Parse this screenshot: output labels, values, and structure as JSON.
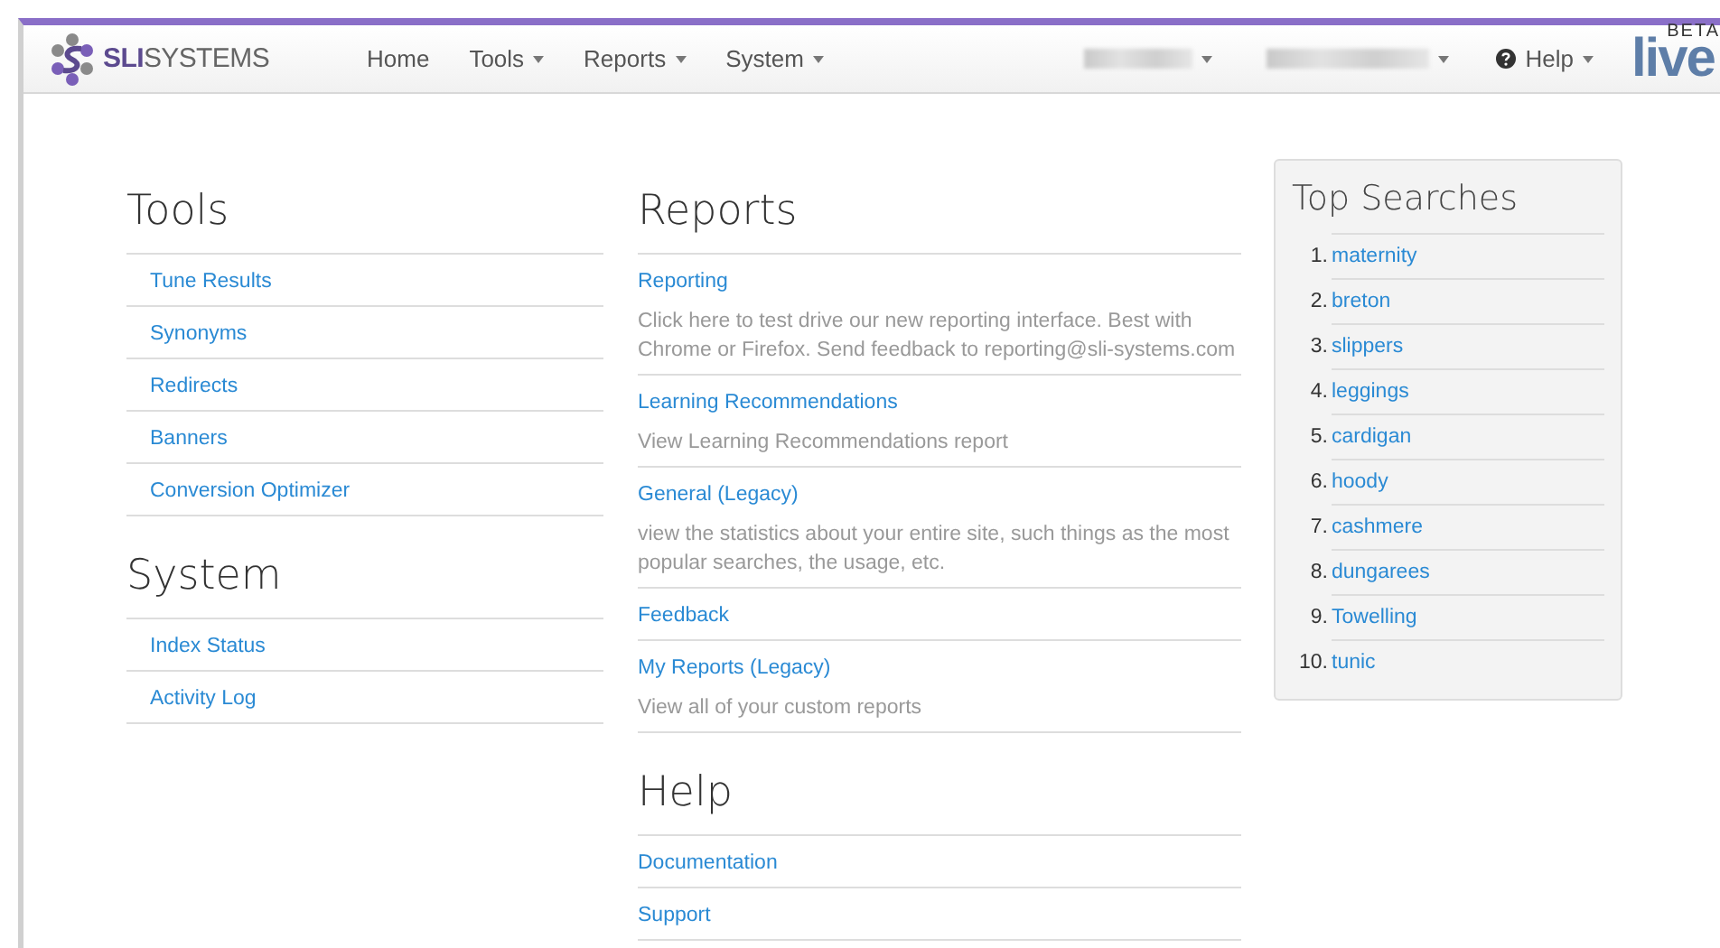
{
  "navbar": {
    "logo": {
      "bold": "SLI",
      "rest": "SYSTEMS"
    },
    "menu": [
      {
        "label": "Home",
        "dropdown": false
      },
      {
        "label": "Tools",
        "dropdown": true
      },
      {
        "label": "Reports",
        "dropdown": true
      },
      {
        "label": "System",
        "dropdown": true
      }
    ],
    "right": [
      {
        "kind": "redacted"
      },
      {
        "kind": "redacted"
      },
      {
        "kind": "help",
        "label": "Help"
      }
    ],
    "badge": {
      "word": "live",
      "tag": "BETA"
    }
  },
  "sections_left": [
    {
      "title": "Tools",
      "links": [
        "Tune Results",
        "Synonyms",
        "Redirects",
        "Banners",
        "Conversion Optimizer"
      ]
    },
    {
      "title": "System",
      "links": [
        "Index Status",
        "Activity Log"
      ]
    }
  ],
  "sections_middle": [
    {
      "title": "Reports",
      "items": [
        {
          "link": "Reporting",
          "description": "Click here to test drive our new reporting interface. Best with Chrome or Firefox. Send feedback to reporting@sli-systems.com"
        },
        {
          "link": "Learning Recommendations",
          "description": "View Learning Recommendations report"
        },
        {
          "link": "General (Legacy)",
          "description": "view the statistics about your entire site, such things as the most popular searches, the usage, etc."
        },
        {
          "link": "Feedback"
        },
        {
          "link": "My Reports (Legacy)",
          "description": "View all of your custom reports"
        }
      ]
    },
    {
      "title": "Help",
      "items": [
        {
          "link": "Documentation"
        },
        {
          "link": "Support"
        }
      ]
    }
  ],
  "top_searches": {
    "title": "Top Searches",
    "items": [
      {
        "rank": "1.",
        "term": "maternity"
      },
      {
        "rank": "2.",
        "term": "breton"
      },
      {
        "rank": "3.",
        "term": "slippers"
      },
      {
        "rank": "4.",
        "term": "leggings"
      },
      {
        "rank": "5.",
        "term": "cardigan"
      },
      {
        "rank": "6.",
        "term": "hoody"
      },
      {
        "rank": "7.",
        "term": "cashmere"
      },
      {
        "rank": "8.",
        "term": "dungarees"
      },
      {
        "rank": "9.",
        "term": "Towelling"
      },
      {
        "rank": "10.",
        "term": "tunic"
      }
    ]
  }
}
